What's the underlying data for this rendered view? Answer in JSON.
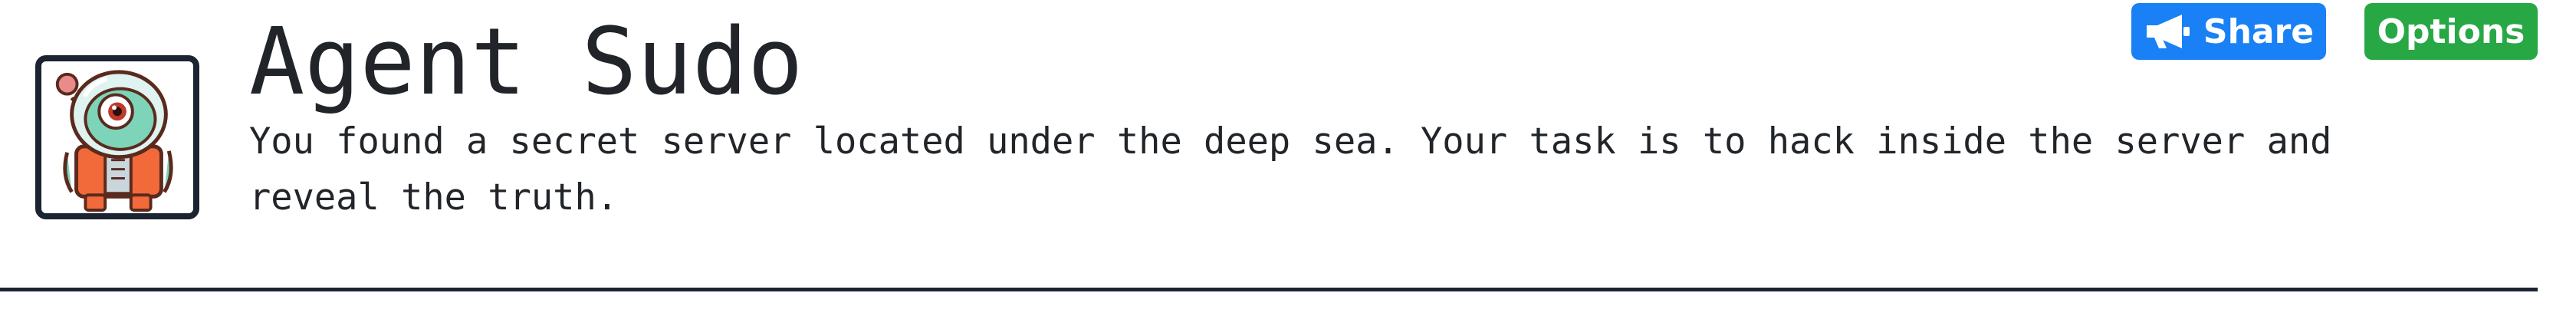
{
  "room": {
    "title": "Agent Sudo",
    "description": "You found a secret server located under the deep sea. Your task is to hack inside the server and reveal the truth.",
    "icon": "alien-astronaut-icon"
  },
  "actions": {
    "share_label": "Share",
    "share_icon": "megaphone-icon",
    "options_label": "Options"
  },
  "colors": {
    "share_button": "#1a80f5",
    "options_button": "#28a745",
    "divider": "#1c2331",
    "text": "#212529"
  }
}
